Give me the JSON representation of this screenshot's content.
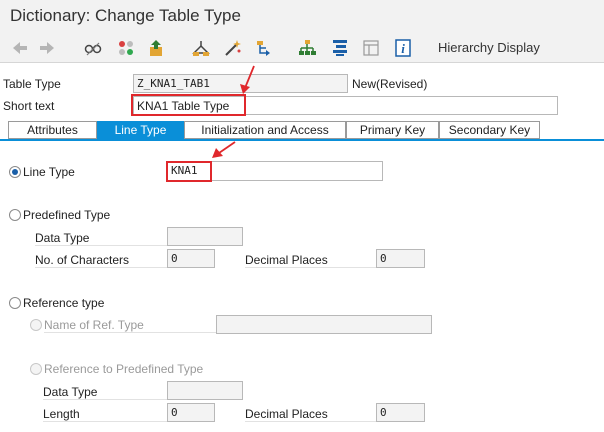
{
  "window": {
    "title": "Dictionary: Change Table Type"
  },
  "toolbar": {
    "icons": [
      "back-icon",
      "forward-icon",
      "display-change-icon",
      "other-object-icon",
      "activate-icon",
      "check-icon",
      "test-icon",
      "where-used-icon",
      "object-list-icon",
      "navigation-window-icon",
      "layout-icon",
      "info-icon"
    ],
    "hierarchy_label": "Hierarchy Display"
  },
  "header": {
    "table_type_label": "Table Type",
    "table_type_value": "Z_KNA1_TAB1",
    "status": "New(Revised)",
    "short_text_label": "Short text",
    "short_text_value": "KNA1 Table Type"
  },
  "tabs": [
    {
      "label": "Attributes"
    },
    {
      "label": "Line Type"
    },
    {
      "label": "Initialization and Access"
    },
    {
      "label": "Primary Key"
    },
    {
      "label": "Secondary Key"
    }
  ],
  "line_type": {
    "label": "Line Type",
    "value": "KNA1"
  },
  "predefined": {
    "label": "Predefined Type",
    "data_type_label": "Data Type",
    "data_type_value": "",
    "chars_label": "No. of Characters",
    "chars_value": "0",
    "decimals_label": "Decimal Places",
    "decimals_value": "0"
  },
  "reference": {
    "label": "Reference type",
    "name_label": "Name of Ref. Type",
    "name_value": "",
    "ref_predefined_label": "Reference to Predefined Type",
    "data_type_label": "Data Type",
    "data_type_value": "",
    "length_label": "Length",
    "length_value": "0",
    "decimals_label": "Decimal Places",
    "decimals_value": "0"
  },
  "colors": {
    "accent": "#0a8fd8",
    "highlight": "#e0282c"
  }
}
